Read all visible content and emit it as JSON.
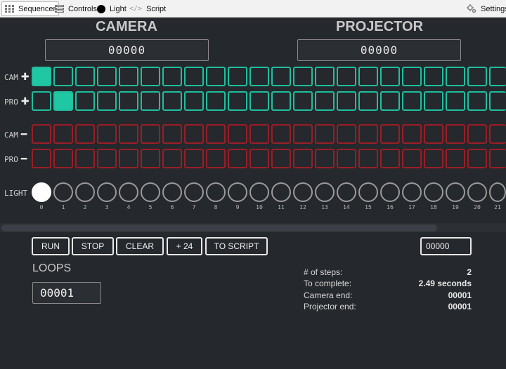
{
  "topbar": {
    "tabs": [
      {
        "label": "Sequencer",
        "icon": "grid-icon",
        "active": true
      },
      {
        "label": "Controls",
        "icon": "sliders-icon",
        "active": false
      },
      {
        "label": "Light",
        "icon": "circle-icon",
        "active": false
      },
      {
        "label": "Script",
        "icon": "code-icon",
        "active": false
      }
    ],
    "settings_label": "Settings"
  },
  "camera": {
    "title": "CAMERA",
    "counter": "00000"
  },
  "projector": {
    "title": "PROJECTOR",
    "counter": "00000"
  },
  "rows": {
    "cam_plus": {
      "label": "CAM",
      "sign": "✚"
    },
    "pro_plus": {
      "label": "PRO",
      "sign": "✚"
    },
    "cam_minus": {
      "label": "CAM",
      "sign": "━"
    },
    "pro_minus": {
      "label": "PRO",
      "sign": "━"
    },
    "light": {
      "label": "LIGHT"
    }
  },
  "sequence": {
    "cam_plus_on": [
      0
    ],
    "pro_plus_on": [
      1
    ],
    "light_on": [
      0
    ],
    "step_numbers": [
      "0",
      "1",
      "2",
      "3",
      "4",
      "5",
      "6",
      "7",
      "8",
      "9",
      "10",
      "11",
      "12",
      "13",
      "14",
      "15",
      "16",
      "17",
      "18",
      "19",
      "20",
      "21"
    ]
  },
  "controls": {
    "run": "RUN",
    "stop": "STOP",
    "clear": "CLEAR",
    "plus24": "+ 24",
    "to_script": "TO SCRIPT",
    "step_field": "00000"
  },
  "loops": {
    "label": "LOOPS",
    "value": "00001"
  },
  "stats": [
    {
      "label": "# of steps:",
      "value": "2"
    },
    {
      "label": "To complete:",
      "value": "2.49 seconds"
    },
    {
      "label": "Camera end:",
      "value": "00001"
    },
    {
      "label": "Projector end:",
      "value": "00001"
    }
  ],
  "colors": {
    "green": "#1fc7a2",
    "red": "#9b1d26",
    "background": "#25282c"
  }
}
